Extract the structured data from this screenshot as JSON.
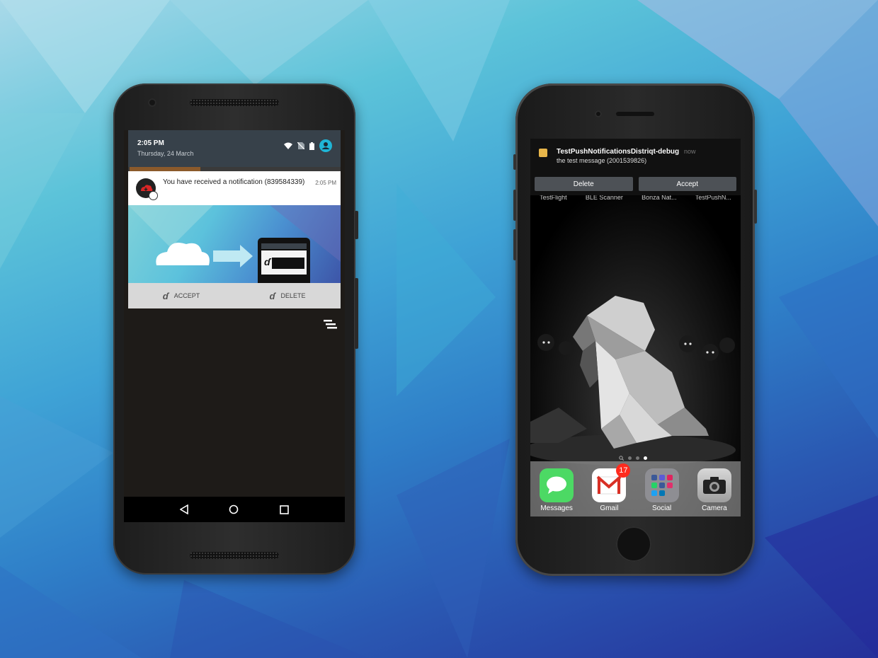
{
  "android": {
    "status": {
      "time": "2:05 PM",
      "date": "Thursday, 24 March"
    },
    "notification": {
      "title": "You have received a notification (839584339)",
      "time": "2:05 PM",
      "accept_label": "ACCEPT",
      "delete_label": "DELETE"
    },
    "nav": {
      "back_icon": "back-triangle-icon",
      "home_icon": "home-circle-icon",
      "recents_icon": "recents-square-icon"
    }
  },
  "iphone": {
    "notification": {
      "app_title": "TestPushNotificationsDistriqt-debug",
      "message": "the test message (2001539826)",
      "time": "now",
      "delete_label": "Delete",
      "accept_label": "Accept"
    },
    "home_apps": [
      "TestFlight",
      "BLE Scanner",
      "Bonza Nat...",
      "TestPushN..."
    ],
    "dock": [
      {
        "label": "Messages",
        "icon": "messages-icon",
        "color": "#4cd964"
      },
      {
        "label": "Gmail",
        "icon": "gmail-icon",
        "color": "#ffffff",
        "badge": "17"
      },
      {
        "label": "Social",
        "icon": "social-folder-icon",
        "color": "#8e8e93"
      },
      {
        "label": "Camera",
        "icon": "camera-icon",
        "color": "#bdbdbd"
      }
    ]
  }
}
